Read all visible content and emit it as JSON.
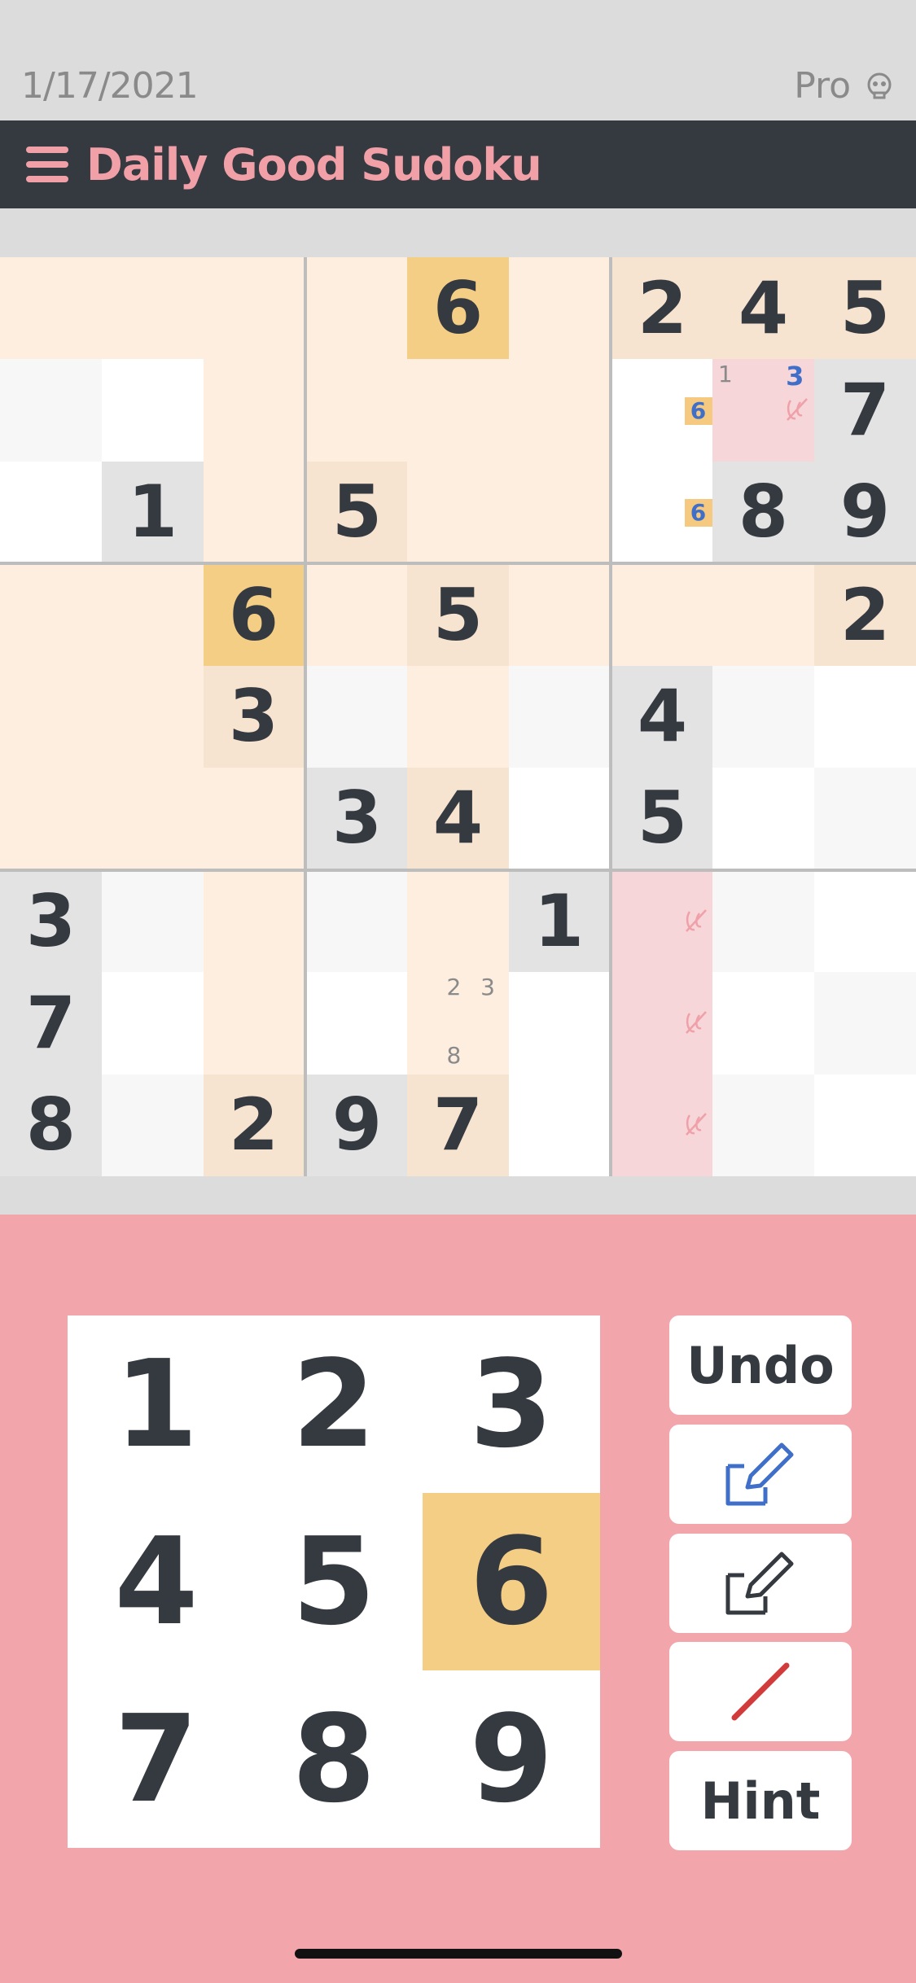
{
  "status": {
    "date": "1/17/2021",
    "pro_label": "Pro",
    "pro_icon": "skull-icon"
  },
  "app": {
    "title": "Daily Good Sudoku",
    "menu_icon": "hamburger-icon"
  },
  "colors": {
    "cell_white": "#ffffff",
    "cell_light": "#f7f7f7",
    "cell_given": "#e3e3e3",
    "cell_peach": "#fdeee0",
    "cell_peach_dark": "#f6e3d0",
    "cell_gold": "#f5ce85",
    "cell_pink": "#f6d6d9",
    "accent_pink": "#f2a6ac",
    "appbar": "#353940",
    "note_blue": "#3f6fc8",
    "cross_red": "#f0a0a8"
  },
  "board": {
    "rows": [
      [
        {
          "v": "",
          "bg": "peach"
        },
        {
          "v": "",
          "bg": "peach"
        },
        {
          "v": "",
          "bg": "peach"
        },
        {
          "v": "",
          "bg": "peach"
        },
        {
          "v": "6",
          "bg": "gold"
        },
        {
          "v": "",
          "bg": "peach"
        },
        {
          "v": "2",
          "bg": "peachdark"
        },
        {
          "v": "4",
          "bg": "peachdark"
        },
        {
          "v": "5",
          "bg": "peachdark"
        }
      ],
      [
        {
          "v": "",
          "bg": "light"
        },
        {
          "v": "",
          "bg": "white"
        },
        {
          "v": "",
          "bg": "peach"
        },
        {
          "v": "",
          "bg": "peach"
        },
        {
          "v": "",
          "bg": "peach"
        },
        {
          "v": "",
          "bg": "peach"
        },
        {
          "v": "",
          "bg": "white",
          "notes": [
            {
              "t": "6",
              "pos": 5,
              "style": "boxed"
            }
          ]
        },
        {
          "v": "",
          "bg": "pink",
          "notes": [
            {
              "t": "1",
              "pos": 0,
              "style": "plain"
            },
            {
              "t": "3",
              "pos": 2,
              "style": "blue"
            }
          ],
          "cross": true
        },
        {
          "v": "7",
          "bg": "given"
        }
      ],
      [
        {
          "v": "",
          "bg": "white"
        },
        {
          "v": "1",
          "bg": "given"
        },
        {
          "v": "",
          "bg": "peach"
        },
        {
          "v": "5",
          "bg": "peachdark"
        },
        {
          "v": "",
          "bg": "peach"
        },
        {
          "v": "",
          "bg": "peach"
        },
        {
          "v": "",
          "bg": "white",
          "notes": [
            {
              "t": "6",
              "pos": 5,
              "style": "boxed"
            }
          ]
        },
        {
          "v": "8",
          "bg": "given"
        },
        {
          "v": "9",
          "bg": "given"
        }
      ],
      [
        {
          "v": "",
          "bg": "peach"
        },
        {
          "v": "",
          "bg": "peach"
        },
        {
          "v": "6",
          "bg": "gold"
        },
        {
          "v": "",
          "bg": "peach"
        },
        {
          "v": "5",
          "bg": "peachdark"
        },
        {
          "v": "",
          "bg": "peach"
        },
        {
          "v": "",
          "bg": "peach"
        },
        {
          "v": "",
          "bg": "peach"
        },
        {
          "v": "2",
          "bg": "peachdark"
        }
      ],
      [
        {
          "v": "",
          "bg": "peach"
        },
        {
          "v": "",
          "bg": "peach"
        },
        {
          "v": "3",
          "bg": "peachdark"
        },
        {
          "v": "",
          "bg": "light"
        },
        {
          "v": "",
          "bg": "peach"
        },
        {
          "v": "",
          "bg": "light"
        },
        {
          "v": "4",
          "bg": "given"
        },
        {
          "v": "",
          "bg": "light"
        },
        {
          "v": "",
          "bg": "white"
        }
      ],
      [
        {
          "v": "",
          "bg": "peach"
        },
        {
          "v": "",
          "bg": "peach"
        },
        {
          "v": "",
          "bg": "peach"
        },
        {
          "v": "3",
          "bg": "given"
        },
        {
          "v": "4",
          "bg": "peachdark"
        },
        {
          "v": "",
          "bg": "white"
        },
        {
          "v": "5",
          "bg": "given"
        },
        {
          "v": "",
          "bg": "white"
        },
        {
          "v": "",
          "bg": "light"
        }
      ],
      [
        {
          "v": "3",
          "bg": "given"
        },
        {
          "v": "",
          "bg": "light"
        },
        {
          "v": "",
          "bg": "peach"
        },
        {
          "v": "",
          "bg": "light"
        },
        {
          "v": "",
          "bg": "peach"
        },
        {
          "v": "1",
          "bg": "given"
        },
        {
          "v": "",
          "bg": "pink",
          "cross": true
        },
        {
          "v": "",
          "bg": "light"
        },
        {
          "v": "",
          "bg": "white"
        }
      ],
      [
        {
          "v": "7",
          "bg": "given"
        },
        {
          "v": "",
          "bg": "white"
        },
        {
          "v": "",
          "bg": "peach"
        },
        {
          "v": "",
          "bg": "white"
        },
        {
          "v": "",
          "bg": "peach",
          "notes": [
            {
              "t": "2",
              "pos": 1,
              "style": "plain"
            },
            {
              "t": "3",
              "pos": 2,
              "style": "plain"
            },
            {
              "t": "8",
              "pos": 7,
              "style": "plain"
            }
          ]
        },
        {
          "v": "",
          "bg": "white"
        },
        {
          "v": "",
          "bg": "pink",
          "cross": true
        },
        {
          "v": "",
          "bg": "white"
        },
        {
          "v": "",
          "bg": "light"
        }
      ],
      [
        {
          "v": "8",
          "bg": "given"
        },
        {
          "v": "",
          "bg": "light"
        },
        {
          "v": "2",
          "bg": "peachdark"
        },
        {
          "v": "9",
          "bg": "given"
        },
        {
          "v": "7",
          "bg": "peachdark"
        },
        {
          "v": "",
          "bg": "white"
        },
        {
          "v": "",
          "bg": "pink",
          "cross": true
        },
        {
          "v": "",
          "bg": "light"
        },
        {
          "v": "",
          "bg": "white"
        }
      ]
    ]
  },
  "numpad": {
    "keys": [
      "1",
      "2",
      "3",
      "4",
      "5",
      "6",
      "7",
      "8",
      "9"
    ],
    "selected": "6"
  },
  "tools": {
    "undo_label": "Undo",
    "pencil_blue_icon": "edit-notes-icon",
    "pencil_dark_icon": "edit-icon",
    "cross_icon": "cross-out-icon",
    "hint_label": "Hint"
  }
}
